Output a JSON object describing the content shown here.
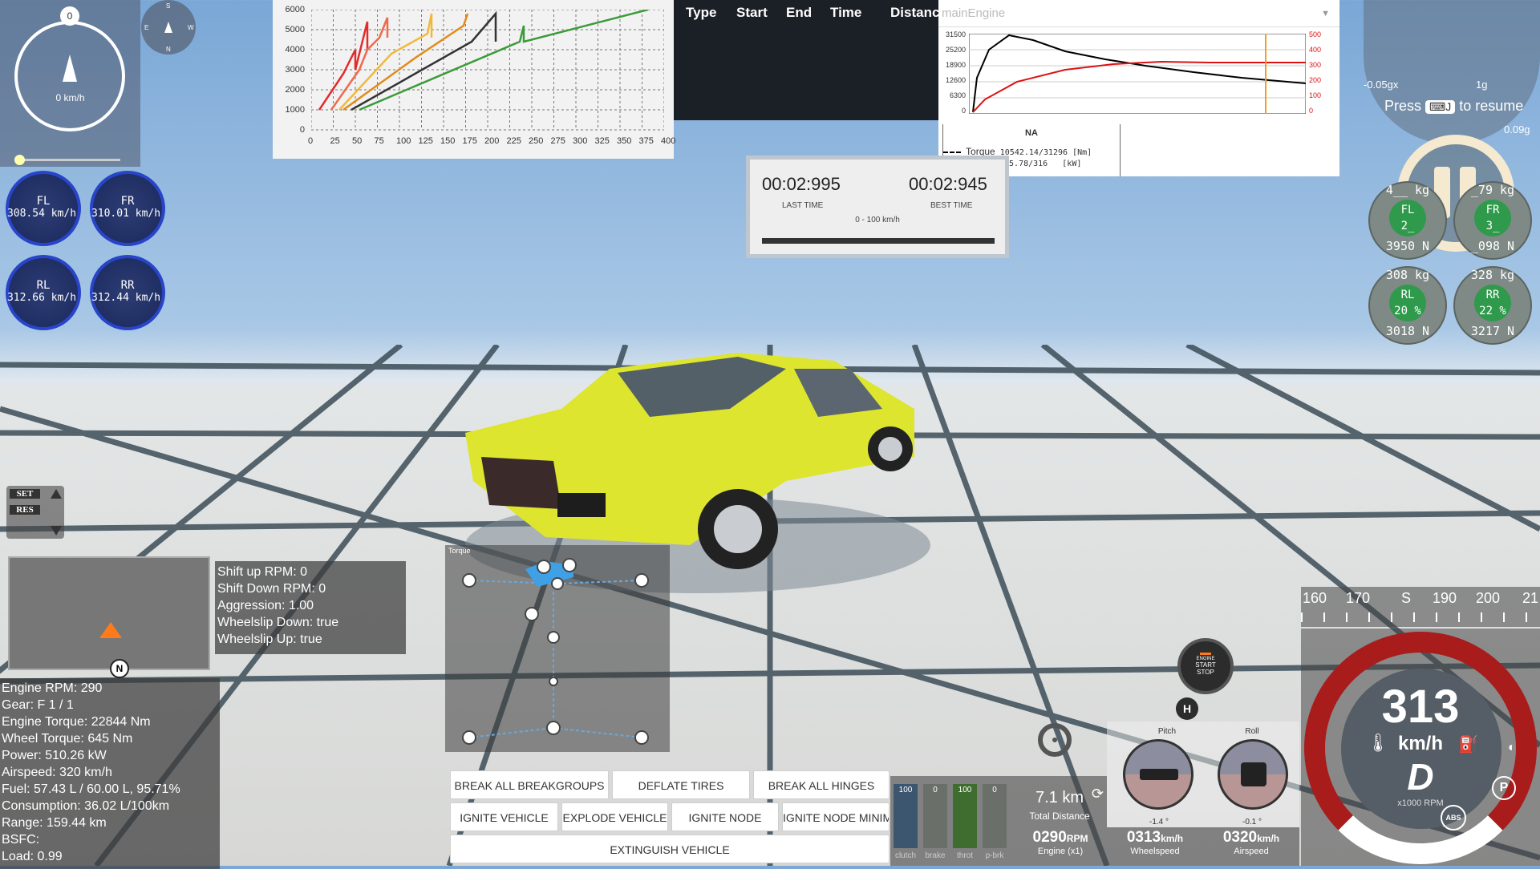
{
  "speedometer": {
    "heading_value": "0",
    "speed": "0 km/h",
    "compass": [
      "S",
      "E",
      "W",
      "N"
    ]
  },
  "wheels_left": [
    {
      "label": "FL",
      "speed": "308.54 km/h"
    },
    {
      "label": "FR",
      "speed": "310.01 km/h"
    },
    {
      "label": "RL",
      "speed": "312.66 km/h"
    },
    {
      "label": "RR",
      "speed": "312.44 km/h"
    }
  ],
  "rpm_chart": {
    "y_ticks": [
      "6000",
      "5000",
      "4000",
      "3000",
      "2000",
      "1000",
      "0"
    ],
    "x_ticks": [
      "0",
      "25",
      "50",
      "75",
      "100",
      "125",
      "150",
      "175",
      "200",
      "225",
      "250",
      "275",
      "300",
      "325",
      "350",
      "375",
      "400"
    ]
  },
  "race_table": {
    "headers": [
      "Type",
      "Start",
      "End",
      "Time",
      "Distance"
    ]
  },
  "engine_chart": {
    "title": "mainEngine",
    "y_left": [
      "31500",
      "25200",
      "18900",
      "12600",
      "6300",
      "0"
    ],
    "y_right": [
      "500",
      "400",
      "300",
      "200",
      "100",
      "0"
    ],
    "legend_title": "NA",
    "torque_label": "Torque",
    "torque_value": "10542.14/31296",
    "torque_unit": "[Nm]",
    "power_value": "315.78/316",
    "power_unit": "[kW]"
  },
  "timer": {
    "last_time": "00:02:995",
    "last_label": "LAST TIME",
    "best_time": "00:02:945",
    "best_label": "BEST TIME",
    "range": "0 - 100 km/h"
  },
  "pause": {
    "press": "Press",
    "key": "J",
    "resume": "to resume",
    "g_neg": "-0.05gx",
    "g_one": "1g",
    "g_val": "0.09g"
  },
  "wheels_right": [
    {
      "load": "4__ kg",
      "label": "FL",
      "pct": "2_",
      "force": "3950 N"
    },
    {
      "load": "_79 kg",
      "label": "FR",
      "pct": "3_",
      "force": "_098 N"
    },
    {
      "load": "308 kg",
      "label": "RL",
      "pct": "20 %",
      "force": "3018 N"
    },
    {
      "load": "328 kg",
      "label": "RR",
      "pct": "22 %",
      "force": "3217 N"
    }
  ],
  "cruise": {
    "set": "SET",
    "res": "RES"
  },
  "minimap": {
    "north": "N"
  },
  "gearbox_info": [
    "Shift up RPM: 0",
    "Shift Down RPM: 0",
    "Aggression: 1.00",
    "Wheelslip Down: true",
    "Wheelslip Up: true"
  ],
  "engine_info": [
    "Engine RPM: 290",
    "Gear: F 1 / 1",
    "Engine Torque: 22844 Nm",
    "Wheel Torque: 645 Nm",
    "Power: 510.26 kW",
    "Airspeed: 320 km/h",
    "Fuel: 57.43 L / 60.00 L, 95.71%",
    "Consumption: 36.02 L/100km",
    "Range: 159.44 km",
    "BSFC:",
    "Load: 0.99"
  ],
  "torque_panel": {
    "title": "Torque"
  },
  "buttons": {
    "break_breakgroups": "BREAK ALL BREAKGROUPS",
    "deflate_tires": "DEFLATE TIRES",
    "break_hinges": "BREAK ALL HINGES",
    "ignite_vehicle": "IGNITE VEHICLE",
    "explode_vehicle": "EXPLODE VEHICLE",
    "ignite_node": "IGNITE NODE",
    "ignite_node_min": "IGNITE NODE MINIM",
    "extinguish": "EXTINGUISH VEHICLE"
  },
  "pedals": [
    {
      "label": "clutch",
      "value": "100",
      "fill": 1.0,
      "color": "#3d5670"
    },
    {
      "label": "brake",
      "value": "0",
      "fill": 0.0,
      "color": "#7a3030"
    },
    {
      "label": "throt",
      "value": "100",
      "fill": 1.0,
      "color": "#3f6d2f"
    },
    {
      "label": "p-brk",
      "value": "0",
      "fill": 0.0,
      "color": "#6a6f6a"
    }
  ],
  "trip": {
    "distance": "7.1 km",
    "label": "Total Distance"
  },
  "readouts": [
    {
      "value": "0290",
      "unit": "RPM",
      "label": "Engine (x1)"
    },
    {
      "value": "0313",
      "unit": "km/h",
      "label": "Wheelspeed"
    },
    {
      "value": "0320",
      "unit": "km/h",
      "label": "Airspeed"
    }
  ],
  "attitude": {
    "pitch_label": "Pitch",
    "pitch_value": "-1.4 °",
    "roll_label": "Roll",
    "roll_value": "-0.1 °"
  },
  "engine_button": {
    "line1": "ENGINE",
    "line2": "START",
    "line3": "STOP"
  },
  "hbrake": "H",
  "compass_strip": [
    "160",
    "170",
    "S",
    "190",
    "200",
    "21"
  ],
  "main_gauge": {
    "speed": "313",
    "unit": "km/h",
    "gear": "D",
    "rpm_label": "x1000 RPM",
    "abs": "ABS",
    "park": "P"
  }
}
